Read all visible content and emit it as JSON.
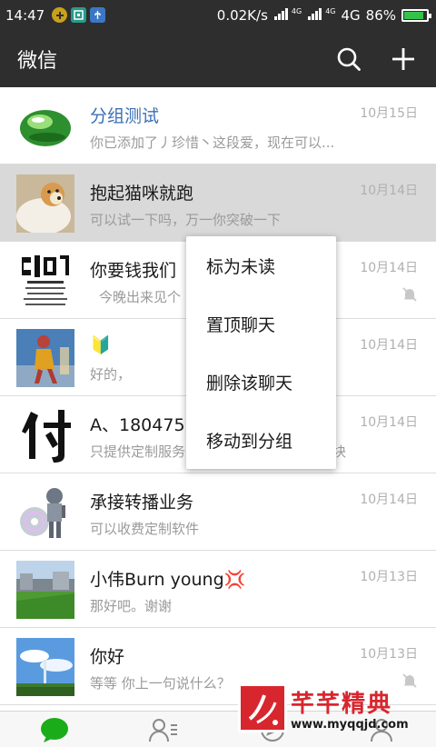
{
  "status_bar": {
    "time": "14:47",
    "net_speed": "0.02K/s",
    "signal_a": "4G",
    "signal_b": "4G",
    "net_type": "4G",
    "battery": "86%",
    "battery_level": 0.86,
    "left_icons": [
      "wifi-plus-icon",
      "qr-scan-icon",
      "usb-icon"
    ]
  },
  "header": {
    "title": "微信",
    "search_icon": "search-icon",
    "add_icon": "plus-icon"
  },
  "chats": [
    {
      "name": "分组测试",
      "message": "你已添加了丿珍惜丶这段爱，现在可以...",
      "time": "10月15日",
      "avatar": "green-droplet-avatar"
    },
    {
      "name": "抱起猫咪就跑",
      "message": "可以试一下吗，万一你突破一下",
      "time": "10月14日",
      "avatar": "dog-avatar"
    },
    {
      "name": "你要钱我们",
      "message": "今晚出来见个",
      "time": "10月14日",
      "avatar": "calligraphy-avatar"
    },
    {
      "name": "🔰",
      "message": "好的，",
      "time": "10月14日",
      "avatar": "figure-avatar"
    },
    {
      "name": "A、180475",
      "message": "只提供定制服务",
      "message_tail": "块",
      "time": "10月14日",
      "avatar": "fu-character-avatar"
    },
    {
      "name": "承接转播业务",
      "message": "可以收费定制软件",
      "time": "10月14日",
      "avatar": "robot-cd-avatar"
    },
    {
      "name": "小伟Burn young💢",
      "message": "那好吧。谢谢",
      "time": "10月13日",
      "avatar": "field-avatar"
    },
    {
      "name": "你好",
      "message": "等等   你上一句说什么？",
      "time": "10月13日",
      "avatar": "sky-avatar"
    }
  ],
  "context_menu": {
    "items": [
      "标为未读",
      "置顶聊天",
      "删除该聊天",
      "移动到分组"
    ]
  },
  "tabbar": {
    "tabs": [
      "chat-bubble-icon",
      "contacts-icon",
      "discover-compass-icon",
      "me-icon"
    ]
  },
  "watermark": {
    "title": "芊芊精典",
    "url": "www.myqqjd.com"
  },
  "colors": {
    "bar": "#2e2e2e",
    "accent": "#1aad19",
    "name_blue": "#3a6fb5",
    "watermark_red": "#d8262e"
  }
}
